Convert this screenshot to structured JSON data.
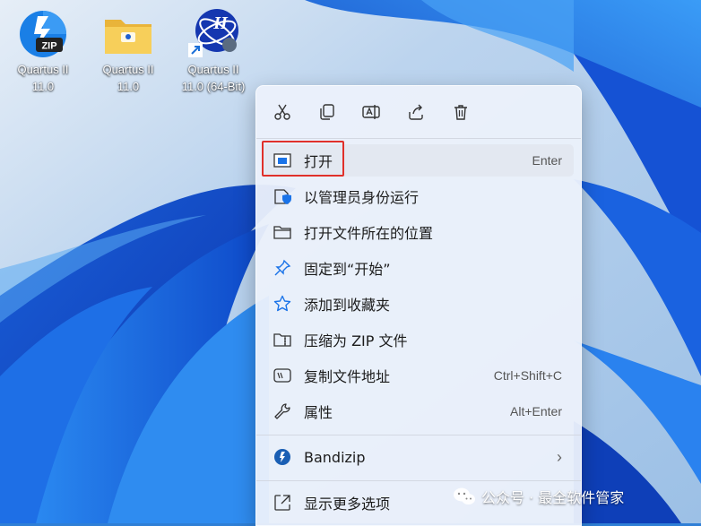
{
  "desktop_icons": [
    {
      "name": "Quartus II",
      "version": "11.0"
    },
    {
      "name": "Quartus II",
      "version": "11.0"
    },
    {
      "name": "Quartus II",
      "version": "11.0 (64-Bit)"
    }
  ],
  "zip_badge": "ZIP",
  "quartus_badge": "II",
  "toolbar": [
    "cut-icon",
    "copy-icon",
    "rename-icon",
    "share-icon",
    "delete-icon"
  ],
  "menu": {
    "open": {
      "label": "打开",
      "key": "Enter"
    },
    "run_as_admin": {
      "label": "以管理员身份运行"
    },
    "open_location": {
      "label": "打开文件所在的位置"
    },
    "pin_start": {
      "label": "固定到“开始”"
    },
    "add_favorites": {
      "label": "添加到收藏夹"
    },
    "compress_zip": {
      "label": "压缩为 ZIP 文件"
    },
    "copy_path": {
      "label": "复制文件地址",
      "key": "Ctrl+Shift+C"
    },
    "properties": {
      "label": "属性",
      "key": "Alt+Enter"
    },
    "bandizip": {
      "label": "Bandizip",
      "arrow": "›"
    },
    "more_options": {
      "label": "显示更多选项"
    }
  },
  "watermark": {
    "text": "公众号 · 最全软件管家"
  },
  "colors": {
    "accent": "#0067c0",
    "highlight_box": "#e0302a",
    "menu_bg": "#ecf1fb"
  }
}
